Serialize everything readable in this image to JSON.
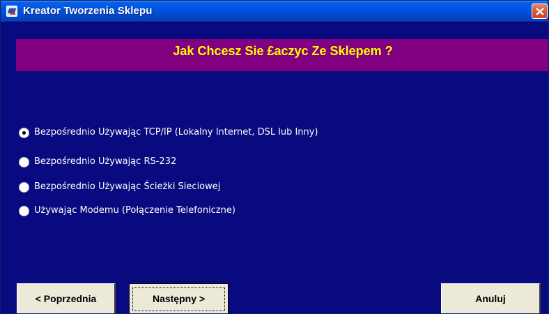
{
  "window": {
    "title": "Kreator Tworzenia Sklepu"
  },
  "header": {
    "text": "Jak Chcesz Sie £aczyc Ze Sklepem ?"
  },
  "options": [
    {
      "label": "Bezpośrednio Używając TCP/IP (Lokalny Internet, DSL lub Inny)",
      "checked": true
    },
    {
      "label": "Bezpośrednio Używając RS-232",
      "checked": false
    },
    {
      "label": "Bezpośrednio Używając Ścieżki Sieciowej",
      "checked": false
    },
    {
      "label": "Używając Modemu (Połączenie Telefoniczne)",
      "checked": false
    }
  ],
  "buttons": {
    "previous": "< Poprzednia",
    "next": "Następny >",
    "cancel": "Anuluj"
  },
  "colors": {
    "body_background": "#0a0a80",
    "header_background": "#800080",
    "header_text": "#ffff00",
    "title_bar": "#0054e3"
  },
  "icons": {
    "app": "app-icon",
    "close": "close-icon"
  }
}
